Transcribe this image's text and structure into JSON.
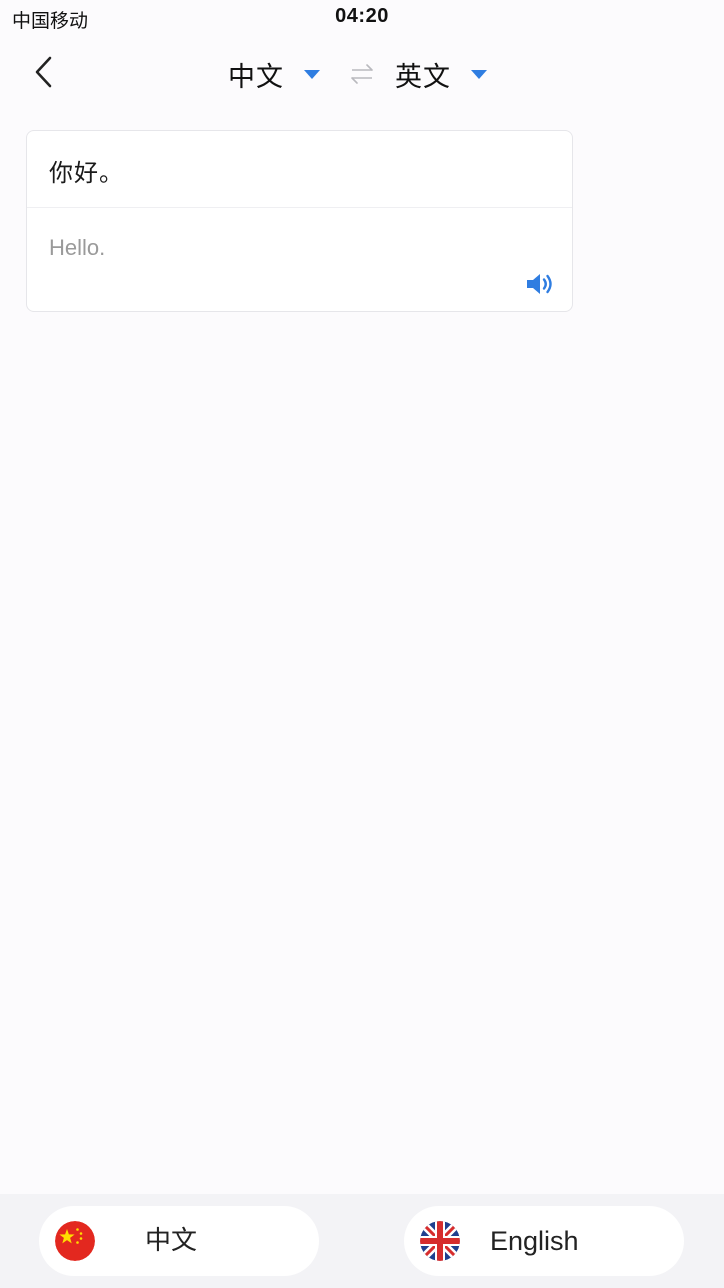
{
  "status_bar": {
    "carrier": "中国移动",
    "time": "04:20"
  },
  "nav": {
    "back_icon": "chevron-left-icon",
    "source_language": "中文",
    "target_language": "英文",
    "swap_icon": "swap-arrows-icon",
    "dropdown_icon": "caret-down-icon"
  },
  "translation": {
    "source_text": "你好。",
    "translated_text": "Hello.",
    "speak_icon": "speaker-icon"
  },
  "bottom_bar": {
    "left_button": {
      "label": "中文",
      "flag_icon": "china-flag-icon"
    },
    "right_button": {
      "label": "English",
      "flag_icon": "uk-flag-icon"
    }
  },
  "colors": {
    "accent": "#2f7de1",
    "background": "#fcfbfd",
    "bottom_bar": "#f3f3f6",
    "translated_text": "#9a9a9a"
  }
}
